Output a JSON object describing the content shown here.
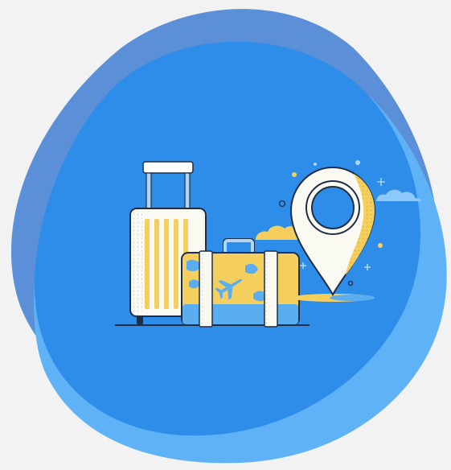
{
  "illustration": {
    "subject": "travel",
    "icons": [
      "rolling-suitcase-icon",
      "travel-case-icon",
      "airplane-icon",
      "location-pin-icon",
      "cloud-icon",
      "sparkle-icon"
    ],
    "colors": {
      "background": "#f2f2f2",
      "blob_back": "#5b8fd8",
      "blob_front": "#2d8de8",
      "blob_light": "#60b2f6",
      "suitcase_body": "#fbfaf2",
      "accent_yellow": "#f4cf5d",
      "accent_blue": "#5aaef0",
      "handle": "#aed6f8",
      "outline": "#1f2e45"
    }
  }
}
